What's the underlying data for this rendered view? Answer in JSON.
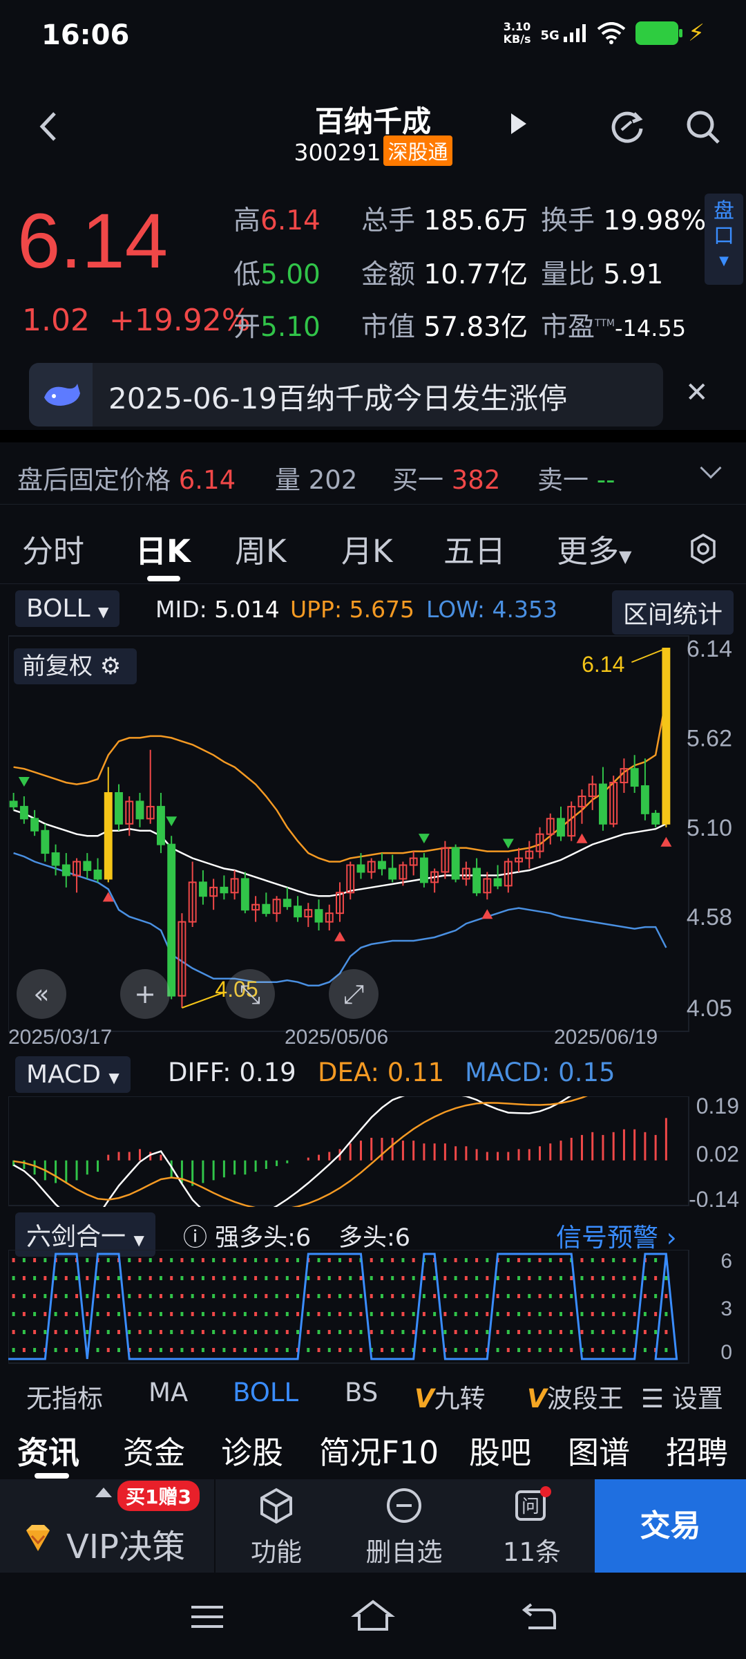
{
  "status_bar": {
    "time": "16:06",
    "net_speed_value": "3.10",
    "net_speed_unit": "KB/s",
    "network": "5G"
  },
  "header": {
    "title": "百纳千成",
    "code": "300291",
    "tag": "深股通"
  },
  "quote": {
    "price": "6.14",
    "change": "1.02",
    "change_pct": "+19.92%",
    "high_label": "高",
    "high": "6.14",
    "low_label": "低",
    "low": "5.00",
    "open_label": "开",
    "open": "5.10",
    "volume_label": "总手",
    "volume": "185.6万",
    "amount_label": "金额",
    "amount": "10.77亿",
    "mcap_label": "市值",
    "mcap": "57.83亿",
    "turnover_label": "换手",
    "turnover": "19.98%",
    "vol_ratio_label": "量比",
    "vol_ratio": "5.91",
    "pe_label": "市盈",
    "pe_sup": "TTM",
    "pe": "-14.55",
    "pankou_label": "盘口"
  },
  "news": {
    "text": "2025-06-19百纳千成今日发生涨停"
  },
  "after_hours": {
    "price_label": "盘后固定价格",
    "price": "6.14",
    "vol_label": "量",
    "vol": "202",
    "bid_label": "买一",
    "bid": "382",
    "ask_label": "卖一",
    "ask": "--"
  },
  "tabs": [
    "分时",
    "日K",
    "周K",
    "月K",
    "五日",
    "更多"
  ],
  "boll": {
    "name": "BOLL",
    "mid_label": "MID:",
    "mid": "5.014",
    "upp_label": "UPP:",
    "upp": "5.675",
    "low_label": "LOW:",
    "low": "4.353",
    "range_btn": "区间统计",
    "adjust": "前复权",
    "max_label": "6.14",
    "min_label": "4.05"
  },
  "macd": {
    "name": "MACD",
    "diff_label": "DIFF:",
    "diff": "0.19",
    "dea_label": "DEA:",
    "dea": "0.11",
    "macd_label": "MACD:",
    "macd": "0.15"
  },
  "six": {
    "name": "六剑合一",
    "strong_label": "强多头:",
    "strong": "6",
    "bull_label": "多头:",
    "bull": "6",
    "signal": "信号预警"
  },
  "indicator_tabs": [
    "无指标",
    "MA",
    "BOLL",
    "BS",
    "九转",
    "波段王",
    "设置"
  ],
  "sub_tabs": [
    "资讯",
    "资金",
    "诊股",
    "简况F10",
    "股吧",
    "图谱",
    "招聘"
  ],
  "bottom": {
    "vip": "VIP决策",
    "promo": "买1赠3",
    "func": "功能",
    "remove": "删自选",
    "qa": "11条",
    "trade": "交易"
  },
  "colors": {
    "up": "#f04848",
    "down": "#31c449",
    "mid_line": "#ffffff",
    "upper_band": "#f59a23",
    "lower_band": "#4a90e2",
    "accent": "#3a8dff"
  },
  "chart_data": {
    "type": "candlestick",
    "x_labels": [
      "2025/03/17",
      "2025/05/06",
      "2025/06/19"
    ],
    "y_ticks": [
      6.14,
      5.62,
      5.1,
      4.58,
      4.05
    ],
    "ylim": [
      4.05,
      6.14
    ],
    "candles": [
      [
        5.25,
        5.3,
        5.2,
        5.22
      ],
      [
        5.22,
        5.28,
        5.12,
        5.15
      ],
      [
        5.15,
        5.2,
        5.05,
        5.08
      ],
      [
        5.08,
        5.12,
        4.9,
        4.95
      ],
      [
        4.95,
        5.0,
        4.82,
        4.88
      ],
      [
        4.88,
        4.95,
        4.75,
        4.82
      ],
      [
        4.82,
        4.92,
        4.72,
        4.9
      ],
      [
        4.9,
        4.95,
        4.8,
        4.85
      ],
      [
        4.85,
        4.92,
        4.78,
        4.8
      ],
      [
        4.8,
        5.45,
        4.78,
        5.3
      ],
      [
        5.3,
        5.35,
        5.08,
        5.12
      ],
      [
        5.12,
        5.28,
        5.05,
        5.25
      ],
      [
        5.25,
        5.3,
        5.1,
        5.15
      ],
      [
        5.15,
        5.55,
        5.12,
        5.22
      ],
      [
        5.22,
        5.3,
        4.95,
        5.0
      ],
      [
        5.0,
        5.05,
        4.1,
        4.12
      ],
      [
        4.12,
        4.6,
        4.05,
        4.55
      ],
      [
        4.55,
        4.9,
        4.52,
        4.78
      ],
      [
        4.78,
        4.85,
        4.65,
        4.7
      ],
      [
        4.7,
        4.8,
        4.62,
        4.75
      ],
      [
        4.75,
        4.82,
        4.68,
        4.72
      ],
      [
        4.72,
        4.85,
        4.68,
        4.8
      ],
      [
        4.8,
        4.84,
        4.6,
        4.62
      ],
      [
        4.62,
        4.7,
        4.55,
        4.65
      ],
      [
        4.65,
        4.72,
        4.58,
        4.6
      ],
      [
        4.6,
        4.7,
        4.55,
        4.68
      ],
      [
        4.68,
        4.75,
        4.62,
        4.64
      ],
      [
        4.64,
        4.7,
        4.55,
        4.58
      ],
      [
        4.58,
        4.66,
        4.52,
        4.62
      ],
      [
        4.62,
        4.68,
        4.5,
        4.55
      ],
      [
        4.55,
        4.65,
        4.5,
        4.6
      ],
      [
        4.6,
        4.78,
        4.55,
        4.72
      ],
      [
        4.72,
        4.9,
        4.68,
        4.88
      ],
      [
        4.88,
        4.95,
        4.8,
        4.84
      ],
      [
        4.84,
        4.92,
        4.8,
        4.9
      ],
      [
        4.9,
        4.95,
        4.82,
        4.86
      ],
      [
        4.86,
        4.94,
        4.78,
        4.8
      ],
      [
        4.8,
        4.9,
        4.76,
        4.88
      ],
      [
        4.88,
        4.96,
        4.82,
        4.92
      ],
      [
        4.92,
        4.95,
        4.75,
        4.78
      ],
      [
        4.78,
        4.86,
        4.72,
        4.84
      ],
      [
        4.84,
        5.02,
        4.8,
        4.98
      ],
      [
        4.98,
        5.0,
        4.78,
        4.8
      ],
      [
        4.8,
        4.9,
        4.76,
        4.86
      ],
      [
        4.86,
        4.92,
        4.7,
        4.72
      ],
      [
        4.72,
        4.84,
        4.68,
        4.8
      ],
      [
        4.8,
        4.88,
        4.74,
        4.76
      ],
      [
        4.76,
        4.92,
        4.72,
        4.9
      ],
      [
        4.9,
        4.98,
        4.84,
        4.92
      ],
      [
        4.92,
        5.02,
        4.86,
        4.96
      ],
      [
        4.96,
        5.1,
        4.92,
        5.06
      ],
      [
        5.06,
        5.18,
        5.0,
        5.15
      ],
      [
        5.15,
        5.22,
        5.02,
        5.05
      ],
      [
        5.05,
        5.25,
        5.02,
        5.22
      ],
      [
        5.22,
        5.32,
        5.12,
        5.28
      ],
      [
        5.28,
        5.4,
        5.2,
        5.35
      ],
      [
        5.35,
        5.45,
        5.08,
        5.12
      ],
      [
        5.12,
        5.4,
        5.1,
        5.36
      ],
      [
        5.36,
        5.5,
        5.3,
        5.44
      ],
      [
        5.44,
        5.52,
        5.3,
        5.34
      ],
      [
        5.34,
        5.5,
        5.14,
        5.18
      ],
      [
        5.18,
        5.2,
        5.1,
        5.12
      ],
      [
        5.12,
        6.14,
        5.1,
        6.14
      ]
    ],
    "boll_upper": [
      5.45,
      5.44,
      5.42,
      5.4,
      5.38,
      5.36,
      5.35,
      5.36,
      5.38,
      5.52,
      5.6,
      5.62,
      5.62,
      5.63,
      5.63,
      5.62,
      5.6,
      5.58,
      5.55,
      5.52,
      5.48,
      5.45,
      5.4,
      5.35,
      5.28,
      5.2,
      5.1,
      5.02,
      4.95,
      4.92,
      4.9,
      4.9,
      4.92,
      4.93,
      4.94,
      4.95,
      4.95,
      4.95,
      4.96,
      4.96,
      4.97,
      4.98,
      4.98,
      4.98,
      4.97,
      4.96,
      4.96,
      4.96,
      4.97,
      4.98,
      5.0,
      5.05,
      5.1,
      5.15,
      5.2,
      5.26,
      5.3,
      5.36,
      5.42,
      5.46,
      5.48,
      5.52,
      5.85
    ],
    "boll_mid": [
      5.2,
      5.18,
      5.15,
      5.12,
      5.1,
      5.08,
      5.06,
      5.05,
      5.05,
      5.08,
      5.08,
      5.09,
      5.08,
      5.08,
      5.05,
      4.98,
      4.95,
      4.92,
      4.9,
      4.88,
      4.86,
      4.85,
      4.83,
      4.81,
      4.79,
      4.77,
      4.75,
      4.73,
      4.71,
      4.7,
      4.7,
      4.71,
      4.73,
      4.74,
      4.75,
      4.76,
      4.77,
      4.78,
      4.79,
      4.8,
      4.81,
      4.82,
      4.82,
      4.82,
      4.82,
      4.82,
      4.82,
      4.83,
      4.84,
      4.85,
      4.87,
      4.89,
      4.91,
      4.94,
      4.97,
      5.0,
      5.02,
      5.04,
      5.06,
      5.07,
      5.08,
      5.09,
      5.12
    ],
    "boll_lower": [
      4.95,
      4.93,
      4.9,
      4.88,
      4.86,
      4.84,
      4.82,
      4.8,
      4.78,
      4.74,
      4.62,
      4.58,
      4.56,
      4.54,
      4.5,
      4.36,
      4.32,
      4.28,
      4.25,
      4.22,
      4.22,
      4.22,
      4.21,
      4.2,
      4.2,
      4.2,
      4.21,
      4.2,
      4.18,
      4.18,
      4.2,
      4.25,
      4.35,
      4.4,
      4.42,
      4.43,
      4.44,
      4.44,
      4.44,
      4.45,
      4.46,
      4.48,
      4.5,
      4.54,
      4.56,
      4.58,
      4.6,
      4.62,
      4.63,
      4.62,
      4.61,
      4.6,
      4.58,
      4.57,
      4.56,
      4.55,
      4.54,
      4.53,
      4.52,
      4.51,
      4.52,
      4.52,
      4.4
    ],
    "macd_hist": [
      -0.02,
      -0.03,
      -0.05,
      -0.07,
      -0.08,
      -0.08,
      -0.07,
      -0.05,
      -0.04,
      0.02,
      0.03,
      0.03,
      0.04,
      0.03,
      0.02,
      -0.06,
      -0.08,
      -0.09,
      -0.08,
      -0.07,
      -0.06,
      -0.05,
      -0.05,
      -0.04,
      -0.03,
      -0.02,
      -0.01,
      0.0,
      0.01,
      0.02,
      0.03,
      0.04,
      0.06,
      0.07,
      0.08,
      0.08,
      0.08,
      0.07,
      0.07,
      0.06,
      0.06,
      0.06,
      0.05,
      0.05,
      0.04,
      0.03,
      0.03,
      0.03,
      0.04,
      0.04,
      0.05,
      0.06,
      0.07,
      0.08,
      0.09,
      0.1,
      0.09,
      0.1,
      0.11,
      0.11,
      0.1,
      0.09,
      0.15
    ],
    "macd_ylim": [
      -0.14,
      0.19
    ],
    "six_sword_ticks": [
      0,
      3,
      6
    ]
  }
}
